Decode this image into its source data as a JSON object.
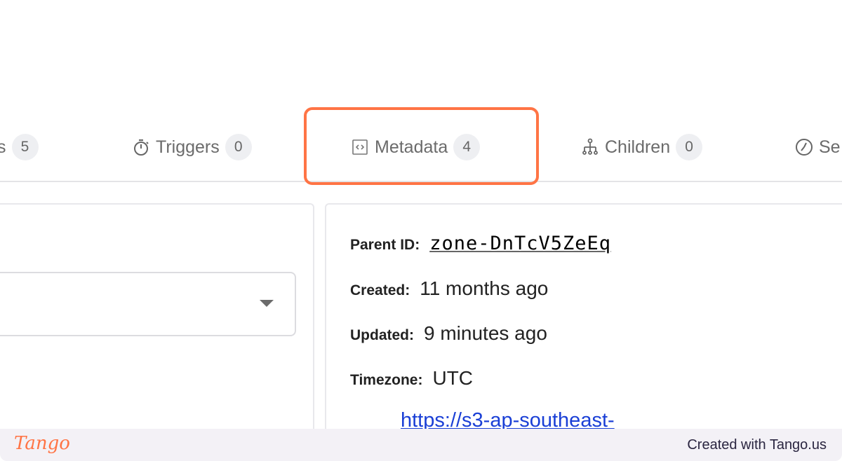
{
  "tabs": [
    {
      "label": "s",
      "count": "5",
      "icon": "none"
    },
    {
      "label": "Triggers",
      "count": "0",
      "icon": "stopwatch-icon"
    },
    {
      "label": "Metadata",
      "count": "4",
      "icon": "code-box-icon"
    },
    {
      "label": "Children",
      "count": "0",
      "icon": "hierarchy-icon"
    },
    {
      "label": "Se",
      "count": "",
      "icon": "clock-icon"
    }
  ],
  "highlight_color": "#ff7445",
  "metadata": {
    "parent_id_label": "Parent ID:",
    "parent_id": "zone-DnTcV5ZeEq",
    "created_label": "Created:",
    "created": "11 months ago",
    "updated_label": "Updated:",
    "updated": "9 minutes ago",
    "timezone_label": "Timezone:",
    "timezone": "UTC",
    "link": "https://s3-ap-southeast-"
  },
  "footer": {
    "logo": "Tango",
    "credit": "Created with Tango.us"
  }
}
